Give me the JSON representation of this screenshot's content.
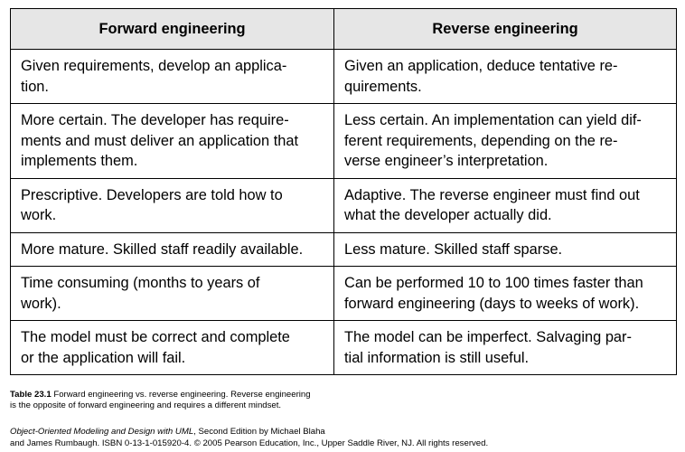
{
  "table": {
    "headers": [
      "Forward engineering",
      "Reverse engineering"
    ],
    "rows": [
      [
        "Given requirements, develop an applica-\ntion.",
        "Given an application, deduce tentative re-\nquirements."
      ],
      [
        "More certain. The developer has require-\nments and must deliver an application that\nimplements them.",
        "Less certain. An implementation can yield dif-\nferent requirements, depending on the re-\nverse engineer’s interpretation."
      ],
      [
        "Prescriptive. Developers are told how to\nwork.",
        "Adaptive. The reverse engineer must find out\nwhat the developer actually did."
      ],
      [
        "More mature. Skilled staff readily available.",
        "Less mature. Skilled staff sparse."
      ],
      [
        "Time consuming (months to years of\nwork).",
        "Can be performed 10 to 100 times faster than\nforward engineering (days to weeks of work)."
      ],
      [
        "The model must be correct and complete\nor the application will fail.",
        "The model can be imperfect. Salvaging par-\ntial information is still useful."
      ]
    ]
  },
  "caption": {
    "number": "Table 23.1",
    "text": " Forward engineering vs. reverse engineering. Reverse engineering\nis the opposite of forward engineering and requires a different mindset."
  },
  "credit": {
    "book_title": "Object-Oriented Modeling and Design with UML",
    "line1_rest": ", Second Edition by Michael Blaha",
    "line2": "and James Rumbaugh. ISBN 0-13-1-015920-4. © 2005 Pearson Education, Inc., Upper Saddle River, NJ. All rights reserved."
  }
}
